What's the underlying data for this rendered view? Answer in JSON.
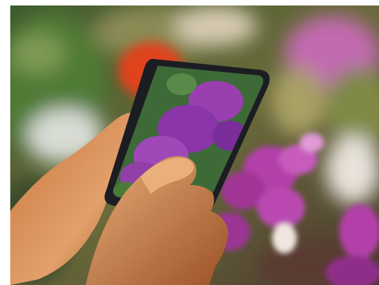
{
  "photo": {
    "subject": "hands-holding-smartphone-photographing-bougainvillea",
    "colors": {
      "background_green": "#5a7040",
      "bokeh_orange": "#e0421a",
      "bougainvillea_magenta": "#b23fa8",
      "phone_body": "#1c1d22",
      "skin": "#d98c55"
    }
  }
}
